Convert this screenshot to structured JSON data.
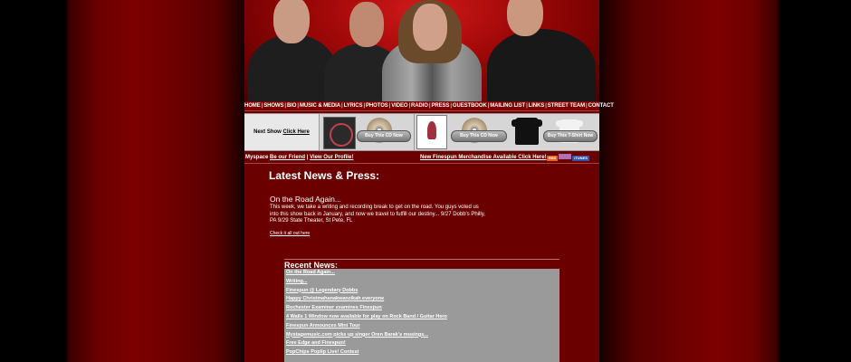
{
  "nav": {
    "items": [
      "HOME",
      "SHOWS",
      "BIO",
      "MUSIC & MEDIA",
      "LYRICS",
      "PHOTOS",
      "VIDEO",
      "RADIO",
      "PRESS",
      "GUESTBOOK",
      "MAILING LIST",
      "LINKS",
      "STREET TEAM",
      "CONTACT"
    ]
  },
  "promo": {
    "next_show_label": "Next Show",
    "next_show_link": "Click Here",
    "buy_cd_1": "Buy This CD Now",
    "buy_cd_2": "Buy This CD Now",
    "buy_shirt": "Buy This T-Shirt Now"
  },
  "linkbar": {
    "myspace_label": "Myspace",
    "be_friend": "Be our Friend",
    "separator": "|",
    "view_profile": "View Our Profile!",
    "merch": "New Finespun Merchandise Available Click Here!",
    "feeds": [
      "RSS",
      "",
      "iTUNES"
    ]
  },
  "latest": {
    "heading": "Latest News & Press:",
    "news_title": "On the Road Again...",
    "news_body": "This week, we take a writing and recording break to get on the road. You guys voted us into this show back in January, and now we travel to fulfill our destiny... 9/27 Dobb's Philly, PA 9/29 State Theater, St Pete, FL",
    "news_link": "Check it all out here"
  },
  "recent": {
    "heading": "Recent News:",
    "items": [
      "On the Road Again...",
      "Writing...",
      "Finespun @ Legendary Dobbs",
      "Happy Christmahanakwanzikah everyone",
      "Rochester Examiner examines Finespun",
      "4 Walls 1 Window now available for play on Rock Band / Guitar Hero",
      "Finespun Announces Mini Tour",
      "Mystagemusic.com picks up singer Oren Barak's musings...",
      "Free Edge and Finespun!",
      "PopChips Poplip Live! Contest"
    ]
  },
  "colors": {
    "page_bg": "#000000",
    "content_bg": "#6a0000",
    "recent_box": "#9a9a9a",
    "rss": "#e8601c",
    "itunes": "#3a50a0"
  }
}
